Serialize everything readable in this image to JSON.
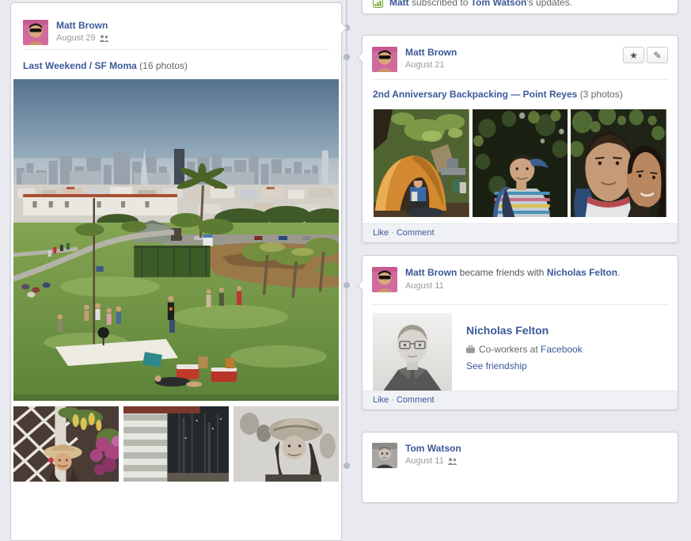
{
  "colors": {
    "page_bg": "#e9eaef",
    "card_bg": "#ffffff",
    "card_border": "#cccccc",
    "link_blue": "#3b5998",
    "body_gray": "#666666",
    "date_gray": "#999999",
    "footer_bg": "#f0f1f5",
    "spine_line": "#ccd1dd",
    "spine_dot": "#b2b9c9",
    "subscribe_green": "#71a424"
  },
  "left_post": {
    "author": "Matt Brown",
    "date": "August 29",
    "album_title": "Last Weekend / SF Moma",
    "album_count": "(16 photos)"
  },
  "subscribed_story": {
    "actor": "Matt",
    "verb": " subscribed to ",
    "target": "Tom Watson",
    "tail": "'s updates."
  },
  "album_post": {
    "author": "Matt Brown",
    "date": "August 21",
    "album_title": "2nd Anniversary Backpacking — Point Reyes",
    "album_count": "(3 photos)",
    "buttons": {
      "star": "★",
      "edit": "✎"
    }
  },
  "friend_post": {
    "author": "Matt Brown",
    "verb": " became friends with ",
    "friend": "Nicholas Felton",
    "tail": ".",
    "date": "August 11",
    "profile": {
      "name": "Nicholas Felton",
      "work_prefix": "Co-workers at ",
      "work_link": "Facebook",
      "see_friendship": "See friendship"
    }
  },
  "tom_post": {
    "author": "Tom Watson",
    "date": "August 11"
  },
  "footer_links": {
    "like": "Like",
    "separator": "·",
    "comment": "Comment"
  }
}
